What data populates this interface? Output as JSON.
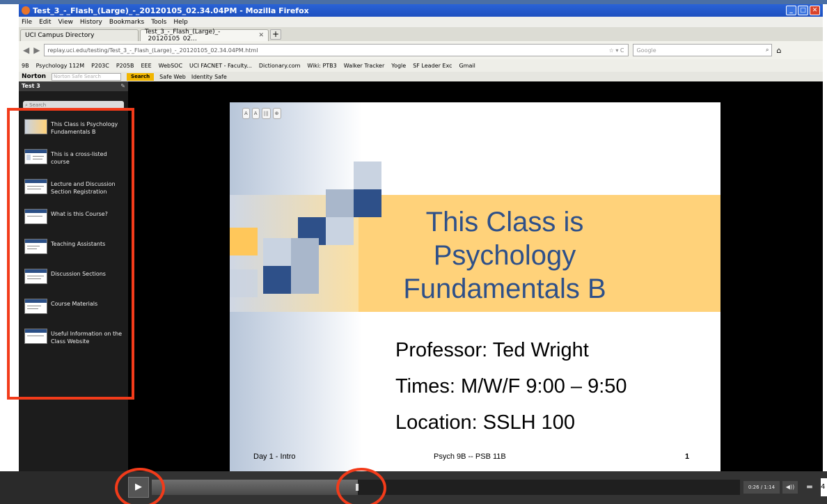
{
  "window": {
    "title": "Test_3_-_Flash_(Large)_-_20120105_02.34.04PM - Mozilla Firefox"
  },
  "menu": [
    "File",
    "Edit",
    "View",
    "History",
    "Bookmarks",
    "Tools",
    "Help"
  ],
  "tabs": [
    {
      "label": "UCI Campus Directory",
      "active": false
    },
    {
      "label": "Test_3_-_Flash_(Large)_-_20120105_02...",
      "active": true
    }
  ],
  "nav": {
    "url": "replay.uci.edu/testing/Test_3_-_Flash_(Large)_-_20120105_02.34.04PM.html",
    "search_placeholder": "Google"
  },
  "bookmarks": [
    "9B",
    "Psychology 112M",
    "P203C",
    "P205B",
    "EEE",
    "WebSOC",
    "UCI FACNET - Faculty...",
    "Dictionary.com",
    "Wiki: PTB3",
    "Walker Tracker",
    "Yogle",
    "SF Leader Exc",
    "Gmail"
  ],
  "norton": {
    "logo": "Norton",
    "placeholder": "Norton Safe Search",
    "search_label": "Search",
    "safe_web": "Safe Web",
    "identity_safe": "Identity Safe"
  },
  "sidebar": {
    "title": "Test 3",
    "search_placeholder": "Search",
    "items": [
      {
        "label": "This Class is Psychology Fundamentals B"
      },
      {
        "label": "This is a cross-listed course"
      },
      {
        "label": "Lecture and Discussion Section Registration"
      },
      {
        "label": "What is this Course?"
      },
      {
        "label": "Teaching Assistants"
      },
      {
        "label": "Discussion Sections"
      },
      {
        "label": "Course Materials"
      },
      {
        "label": "Useful Information on the Class Website"
      }
    ]
  },
  "slide": {
    "tools": [
      "A",
      "A",
      "|||",
      "⊕"
    ],
    "title_lines": [
      "This Class is",
      "Psychology",
      "Fundamentals B"
    ],
    "lines": [
      "Professor: Ted Wright",
      "Times: M/W/F 9:00 – 9:50",
      "Location: SSLH 100"
    ],
    "footer_left": "Day 1 - Intro",
    "footer_center": "Psych 9B -- PSB 11B",
    "footer_right": "1"
  },
  "player": {
    "time": "0:26 / 1:14",
    "progress": 0.35,
    "page_number": "4"
  },
  "colors": {
    "highlight_red": "#f23b1a",
    "slide_blue": "#2e5089",
    "slide_band": "#ffd27a"
  }
}
